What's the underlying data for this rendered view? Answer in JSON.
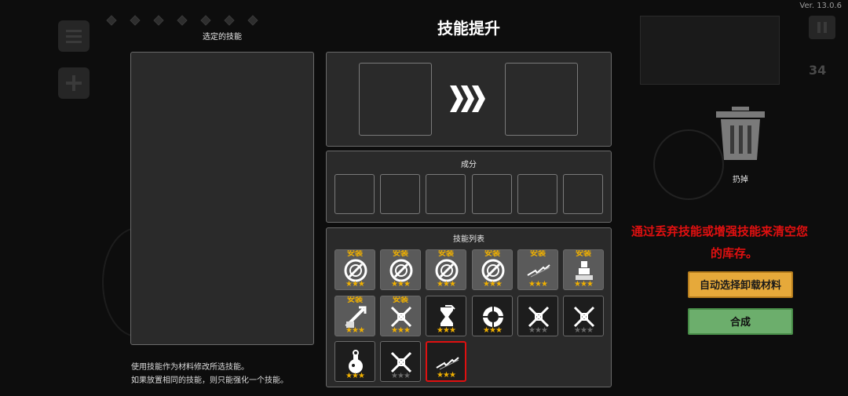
{
  "version": "Ver. 13.0.6",
  "title": "技能提升",
  "selected_skill_label": "选定的技能",
  "components_label": "成分",
  "skill_list_label": "技能列表",
  "hint_line1": "使用技能作为材料修改所选技能。",
  "hint_line2": "如果放置相同的技能，则只能强化一个技能。",
  "discard_label": "扔掉",
  "warning_line1": "通过丢弃技能或增强技能来清空您",
  "warning_line2": "的库存。",
  "auto_select_button": "自动选择卸载材料",
  "combine_button": "合成",
  "coin_count": "34",
  "colors": {
    "accent_gold": "#f0b000",
    "warning_red": "#e01010",
    "auto_btn": "#e6a93a",
    "combine_btn": "#6cae6c"
  },
  "skills": [
    {
      "icon": "shield-orb-icon",
      "equipped": true,
      "equipped_label": "安装",
      "stars": "★★★",
      "star_color": "#f0b000"
    },
    {
      "icon": "shield-orb-icon",
      "equipped": true,
      "equipped_label": "安装",
      "stars": "★★★",
      "star_color": "#f0b000"
    },
    {
      "icon": "shield-orb-icon",
      "equipped": true,
      "equipped_label": "安装",
      "stars": "★★★",
      "star_color": "#f0b000"
    },
    {
      "icon": "shield-orb-icon",
      "equipped": true,
      "equipped_label": "安装",
      "stars": "★★★",
      "star_color": "#f0b000"
    },
    {
      "icon": "lightning-icon",
      "equipped": true,
      "equipped_label": "安装",
      "stars": "★★★",
      "star_color": "#f0b000"
    },
    {
      "icon": "summon-icon",
      "equipped": true,
      "equipped_label": "安装",
      "stars": "★★★",
      "star_color": "#f0b000"
    },
    {
      "icon": "sword-slash-icon",
      "equipped": true,
      "equipped_label": "安装",
      "stars": "★★★",
      "star_color": "#f0b000"
    },
    {
      "icon": "crossed-swords-icon",
      "equipped": true,
      "equipped_label": "安装",
      "stars": "★★★",
      "star_color": "#f0b000"
    },
    {
      "icon": "hourglass-icon",
      "equipped": false,
      "equipped_label": "",
      "stars": "★★★",
      "star_color": "#f0b000"
    },
    {
      "icon": "ring-orb-icon",
      "equipped": false,
      "equipped_label": "",
      "stars": "★★★",
      "star_color": "#f0b000"
    },
    {
      "icon": "crossed-swords-icon",
      "equipped": false,
      "equipped_label": "",
      "stars": "★★★",
      "star_color": "#6a6a6a"
    },
    {
      "icon": "crossed-swords-icon",
      "equipped": false,
      "equipped_label": "",
      "stars": "★★★",
      "star_color": "#6a6a6a"
    },
    {
      "icon": "potion-bomb-icon",
      "equipped": false,
      "equipped_label": "",
      "stars": "★★★",
      "star_color": "#f0b000"
    },
    {
      "icon": "crossed-swords-icon",
      "equipped": false,
      "equipped_label": "",
      "stars": "★★★",
      "star_color": "#6a6a6a"
    },
    {
      "icon": "lightning-icon",
      "equipped": false,
      "equipped_label": "",
      "stars": "★★★",
      "star_color": "#f0b000",
      "selected": true
    }
  ]
}
